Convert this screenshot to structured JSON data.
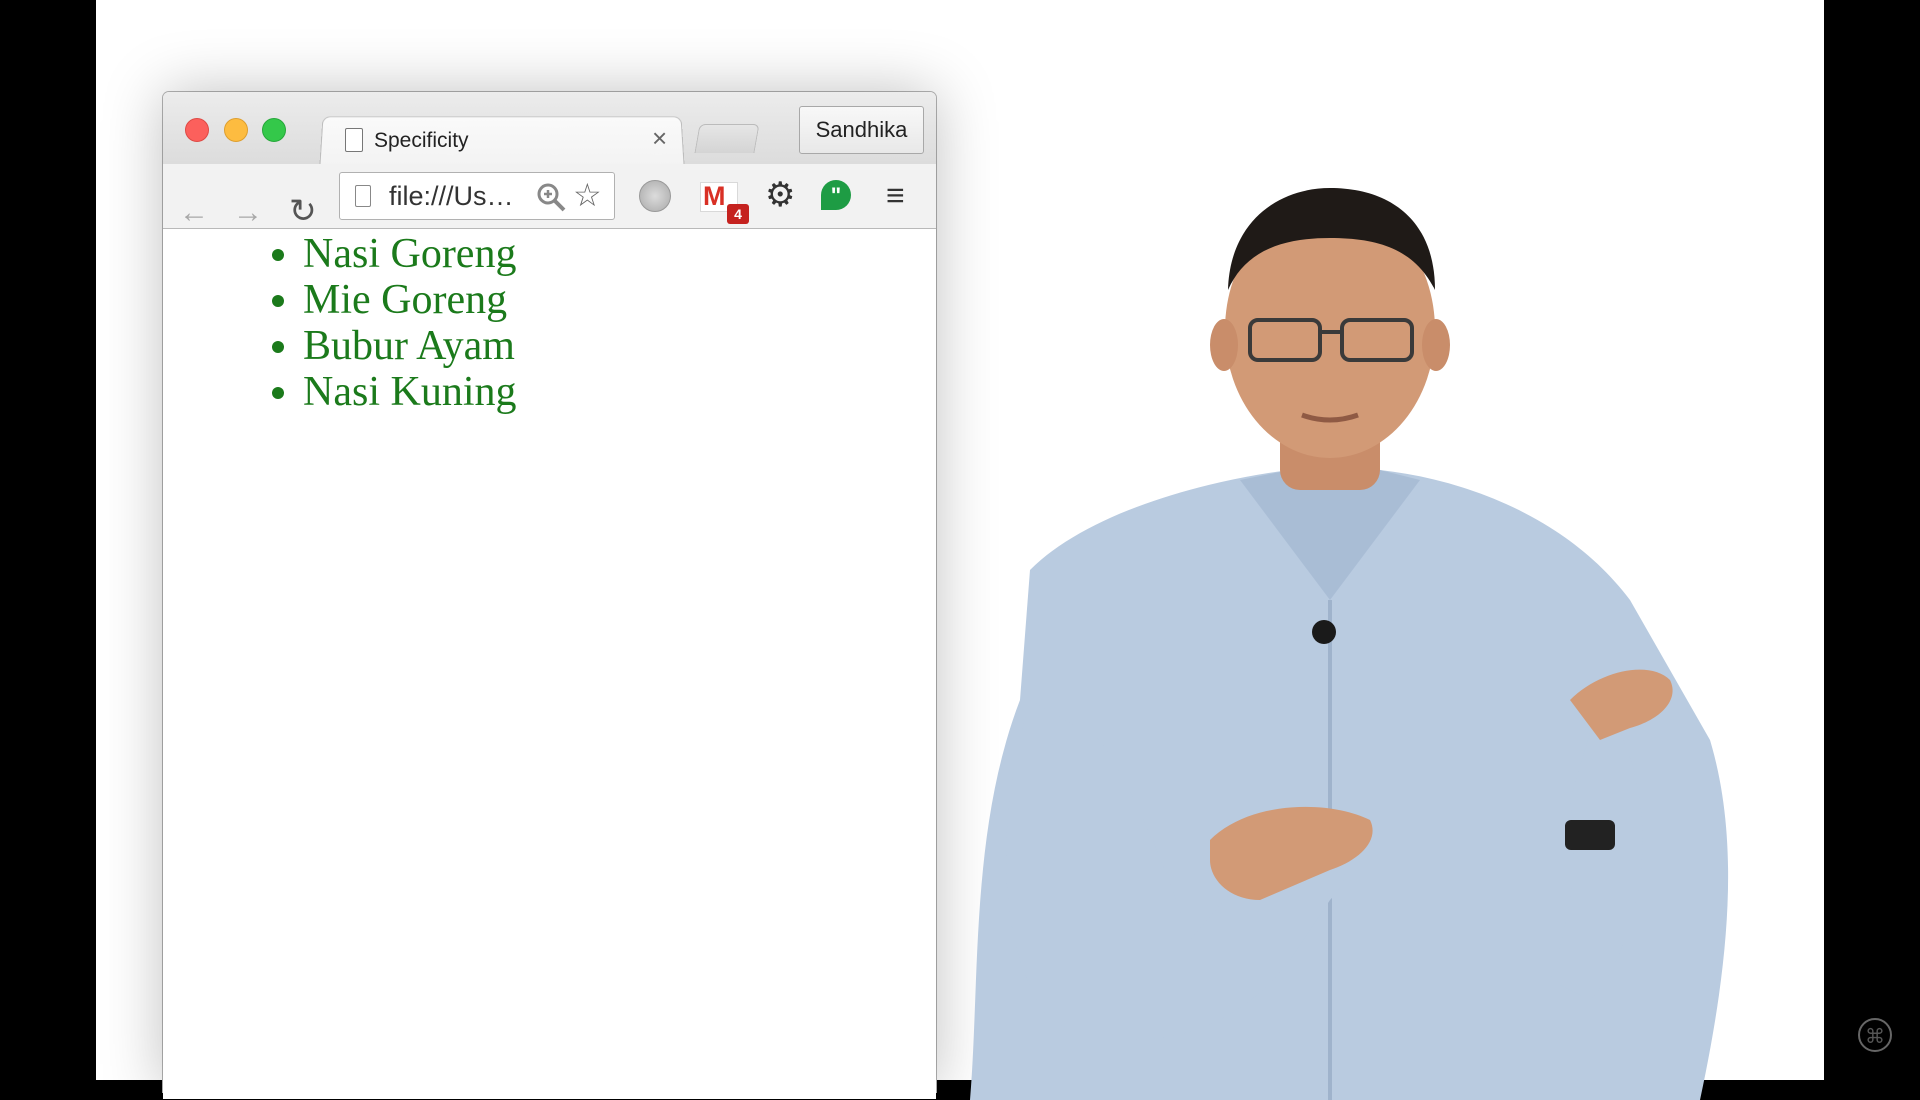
{
  "browser": {
    "tab_title": "Specificity",
    "profile_name": "Sandhika",
    "address_text": "file:///Us…",
    "gmail_unread_count": "4",
    "hangouts_symbol": "\"",
    "icons": [
      "back-arrow",
      "forward-arrow",
      "reload",
      "page",
      "zoom",
      "star",
      "shield",
      "gmail",
      "gear",
      "hangouts",
      "menu"
    ]
  },
  "page": {
    "list_items": [
      "Nasi Goreng",
      "Mie Goreng",
      "Bubur Ayam",
      "Nasi Kuning"
    ],
    "list_color": "#1b7a1b"
  },
  "overlay": {
    "presenter": "person-image",
    "watermark": "watermark-icon"
  }
}
